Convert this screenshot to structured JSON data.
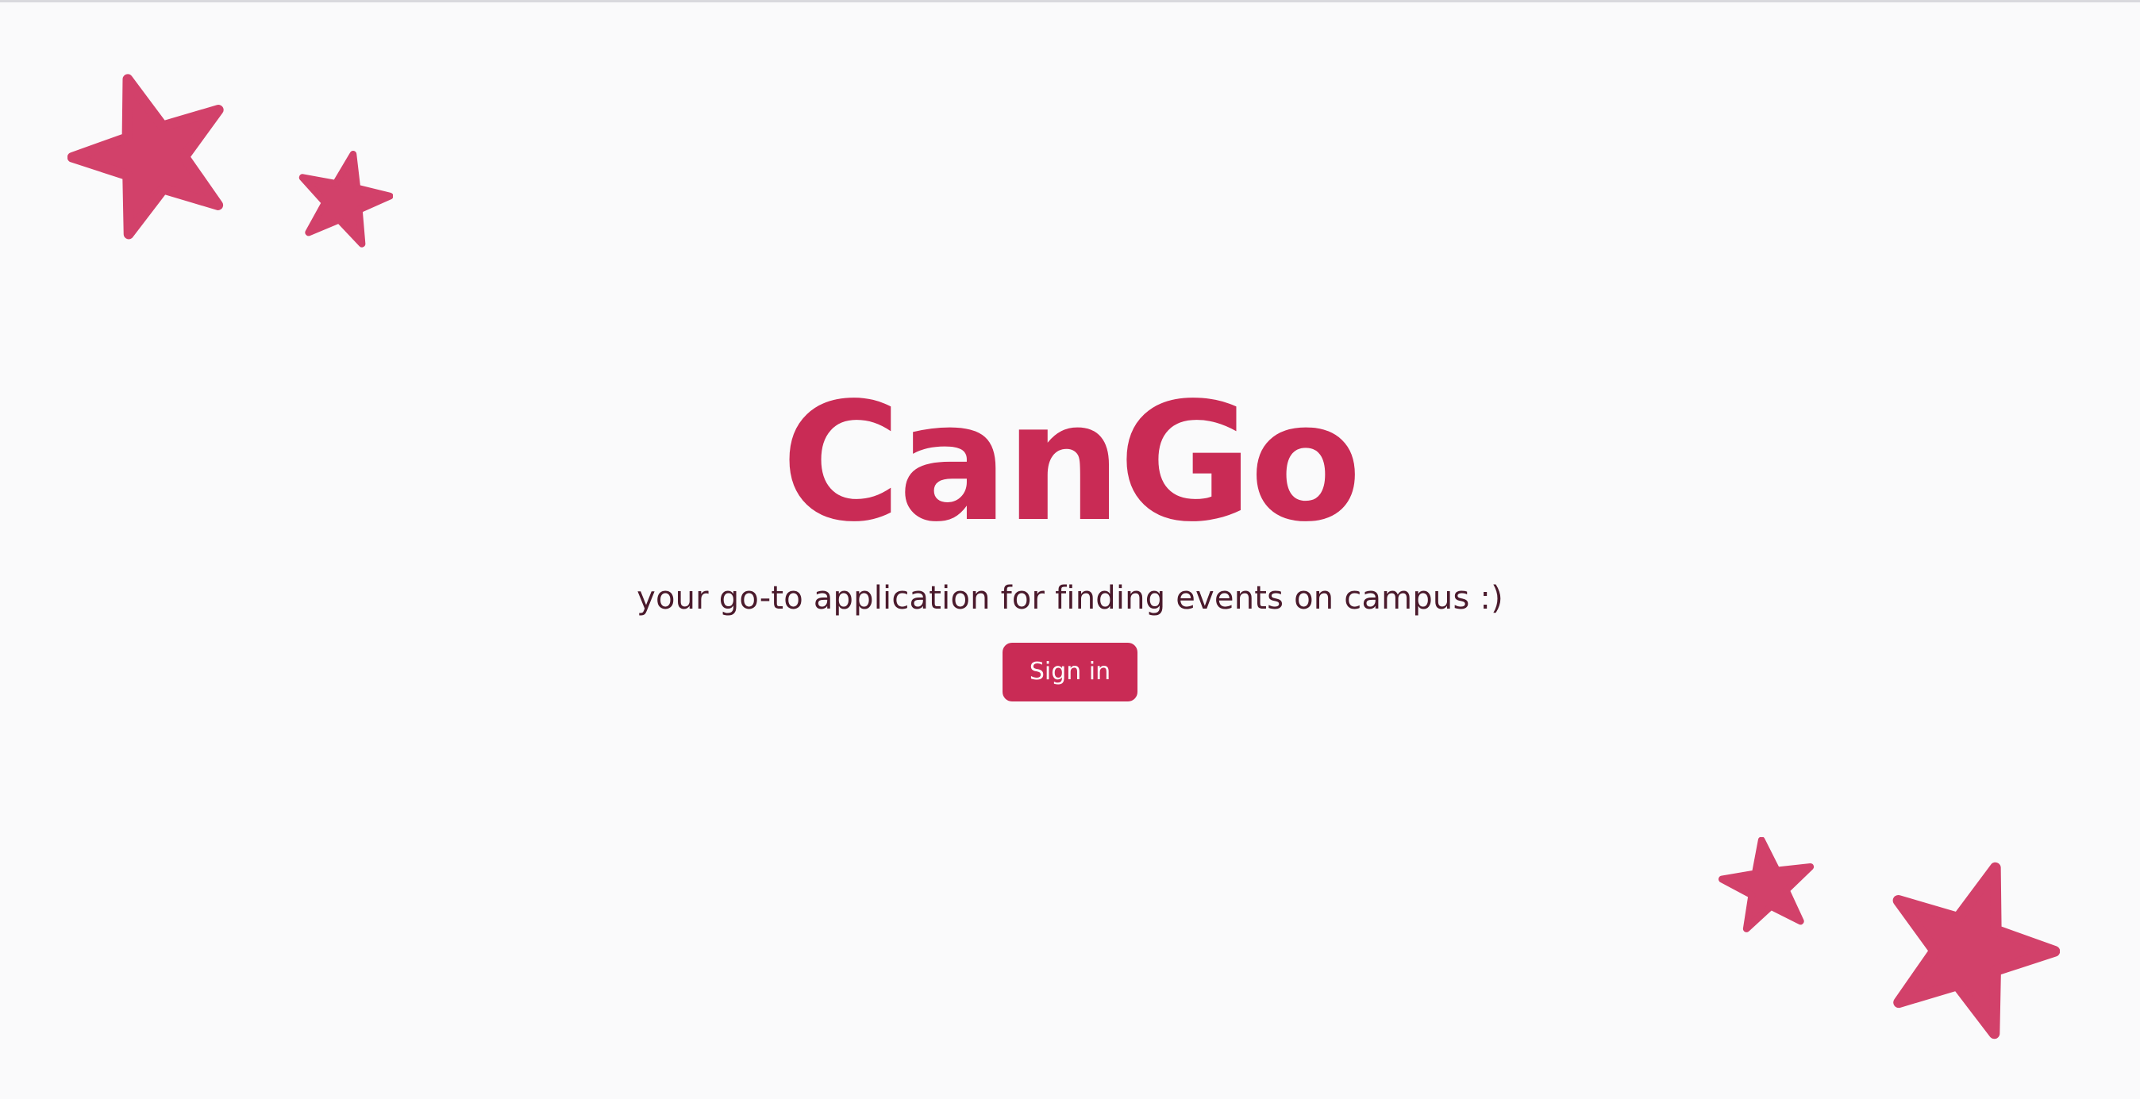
{
  "app": {
    "title": "CanGo",
    "tagline": "your go-to application for finding events on campus :)"
  },
  "actions": {
    "sign_in_label": "Sign in"
  },
  "colors": {
    "brand": "#c92b55",
    "star": "#d2416a",
    "tagline_text": "#4a1a2c",
    "background": "#fafafb",
    "button_text": "#ffffff"
  },
  "decorations": {
    "icons": [
      "star-icon",
      "star-icon",
      "star-icon",
      "star-icon"
    ]
  }
}
